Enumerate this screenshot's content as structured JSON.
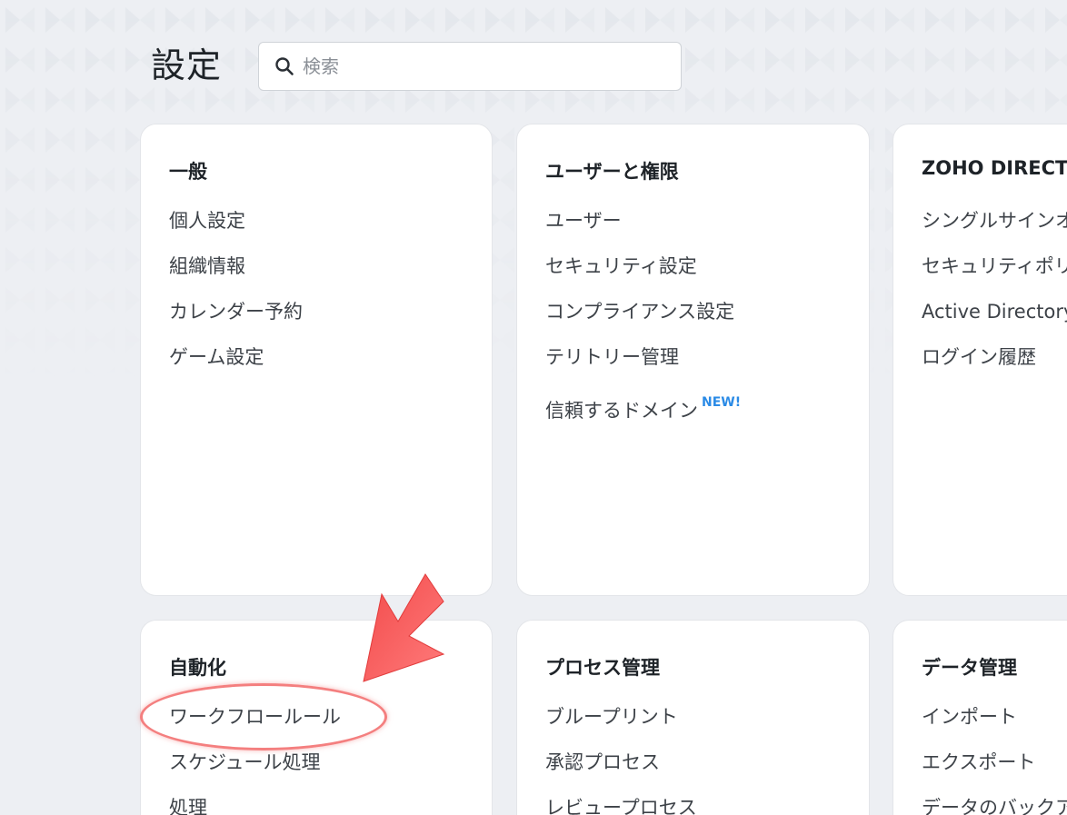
{
  "header": {
    "title": "設定"
  },
  "search": {
    "placeholder": "検索"
  },
  "cards": {
    "general": {
      "title": "一般",
      "items": [
        "個人設定",
        "組織情報",
        "カレンダー予約",
        "ゲーム設定"
      ]
    },
    "users": {
      "title": "ユーザーと権限",
      "items": [
        "ユーザー",
        "セキュリティ設定",
        "コンプライアンス設定",
        "テリトリー管理",
        "信頼するドメイン"
      ],
      "new_badge": "NEW!"
    },
    "zoho_directory": {
      "title": "ZOHO DIRECTORY",
      "items": [
        "シングルサインオン",
        "セキュリティポリシー",
        "Active Directory",
        "ログイン履歴"
      ]
    },
    "automation": {
      "title": "自動化",
      "items": [
        "ワークフロールール",
        "スケジュール処理",
        "処理"
      ]
    },
    "process": {
      "title": "プロセス管理",
      "items": [
        "ブループリント",
        "承認プロセス",
        "レビュープロセス"
      ]
    },
    "data": {
      "title": "データ管理",
      "items": [
        "インポート",
        "エクスポート",
        "データのバックアップ"
      ]
    }
  },
  "colors": {
    "accent_new": "#2b8be6",
    "annotation_red": "#f05454",
    "background": "#edeff3"
  }
}
